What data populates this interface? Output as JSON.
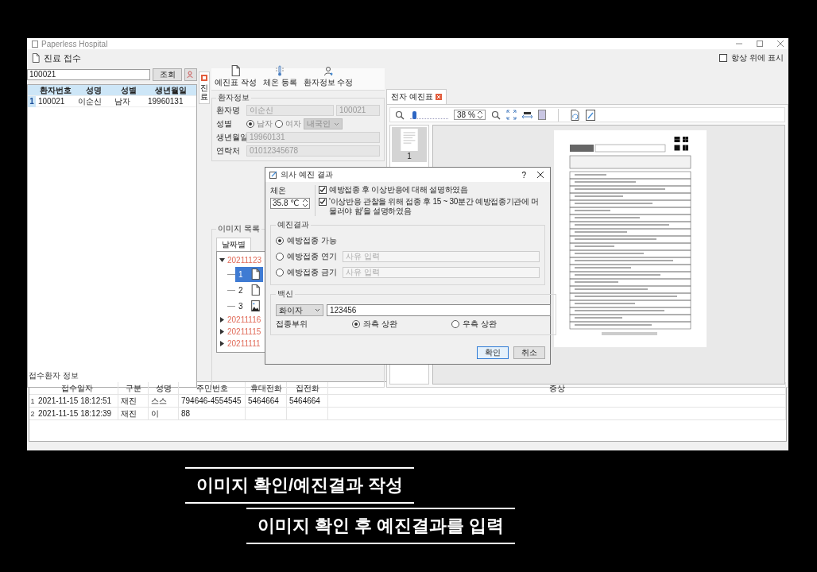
{
  "window": {
    "title": "Paperless Hospital"
  },
  "header": {
    "title": "진료 접수",
    "always_on_top": {
      "label": "항상 위에 표시",
      "checked": false
    }
  },
  "search": {
    "value": "100021",
    "button": "조회"
  },
  "patients": {
    "columns": [
      "환자번호",
      "성명",
      "성별",
      "생년월일"
    ],
    "rows": [
      {
        "index": "1",
        "cells": [
          "100021",
          "이순신",
          "남자",
          "19960131"
        ],
        "selected": true
      }
    ]
  },
  "side_tab": {
    "label": "진료"
  },
  "toolbar": [
    {
      "label": "예진표 작성",
      "kind": "document"
    },
    {
      "label": "체온 등록",
      "kind": "thermometer"
    },
    {
      "label": "환자정보 수정",
      "kind": "person"
    }
  ],
  "patient_info": {
    "title": "환자정보",
    "name_label": "환자명",
    "name": "이순신",
    "id": "100021",
    "sex_label": "성별",
    "sex_options": [
      {
        "label": "남자",
        "selected": true
      },
      {
        "label": "여자",
        "selected": false
      }
    ],
    "nationality": "내국인",
    "birth_label": "생년월일",
    "birth": "19960131",
    "phone_label": "연락처",
    "phone": "01012345678"
  },
  "image_list": {
    "title": "이미지 목록",
    "tab": "날짜별",
    "tree": [
      {
        "label": "20211123",
        "expanded": true,
        "children": [
          {
            "label": "1",
            "kind": "document",
            "selected": true
          },
          {
            "label": "2",
            "kind": "document",
            "selected": false
          },
          {
            "label": "3",
            "kind": "image",
            "selected": false
          }
        ]
      },
      {
        "label": "20211116",
        "expanded": false
      },
      {
        "label": "20211115",
        "expanded": false
      },
      {
        "label": "20211111",
        "expanded": false
      }
    ]
  },
  "viewer": {
    "tab": "전자 예진표",
    "zoom": {
      "level": 0.08,
      "reading": "38 %"
    },
    "pages": [
      {
        "label": "1",
        "selected": true
      }
    ]
  },
  "dialog": {
    "title": "의사 예진 결과",
    "help": "?",
    "temperature_label": "체온",
    "temperature": "35.8 ℃",
    "checks": [
      {
        "label": "예방접종 후 이상반응에 대해 설명하였음",
        "checked": true
      },
      {
        "label": "'이상반응 관찰을 위해 접종 후 15 ~ 30분간 예방접종기관에 머물러야 함'을 설명하였음",
        "checked": true
      }
    ],
    "result_title": "예진결과",
    "results": [
      {
        "label": "예방접종 가능",
        "selected": true
      },
      {
        "label": "예방접종 연기",
        "selected": false,
        "placeholder": "사유 입력"
      },
      {
        "label": "예방접종 금기",
        "selected": false,
        "placeholder": "사유 입력"
      }
    ],
    "vaccine_title": "백신",
    "vaccine": "화이자",
    "lot": "123456",
    "site_label": "접종부위",
    "sites": [
      {
        "label": "좌측 상완",
        "selected": true
      },
      {
        "label": "우측 상완",
        "selected": false
      }
    ],
    "buttons": [
      "확인",
      "취소"
    ]
  },
  "reception": {
    "title": "접수환자 정보",
    "columns": [
      "접수일자",
      "구분",
      "성명",
      "주민번호",
      "휴대전화",
      "집전화",
      "증상"
    ],
    "rows": [
      {
        "index": "1",
        "cells": [
          "2021-11-15 18:12:51",
          "재진",
          "스스",
          "794646-4554545",
          "5464664",
          "5464664"
        ]
      },
      {
        "index": "2",
        "cells": [
          "2021-11-15 18:12:39",
          "재진",
          "이",
          "88"
        ]
      }
    ]
  },
  "captions": [
    {
      "text": "이미지 확인/예진결과 작성"
    },
    {
      "text": "이미지 확인 후 예진결과를 입력"
    }
  ]
}
